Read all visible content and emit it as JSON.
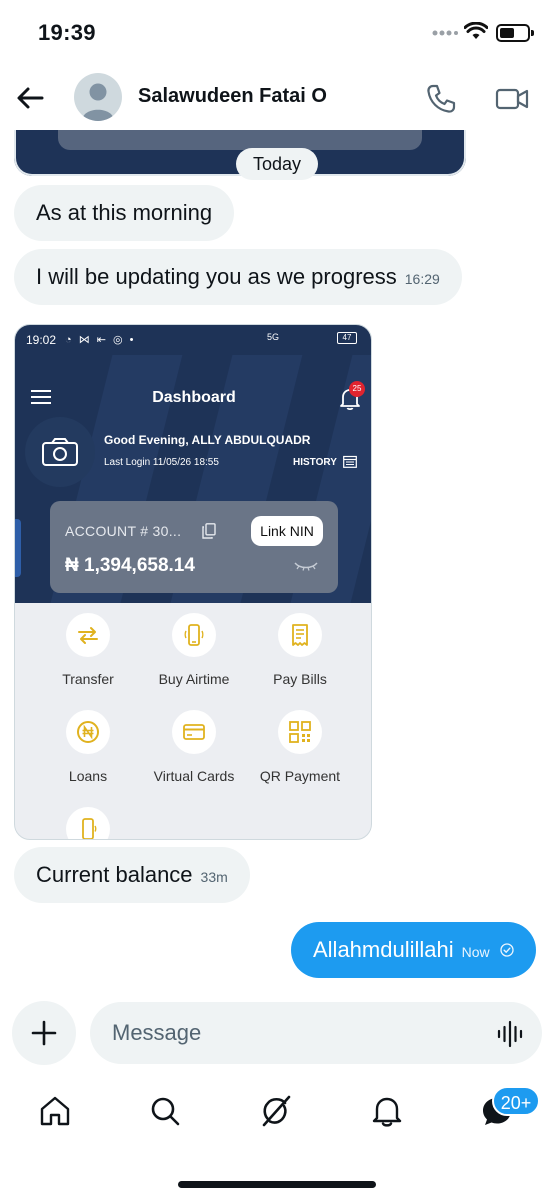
{
  "status_bar": {
    "time": "19:39"
  },
  "header": {
    "contact_name": "Salawudeen Fatai O",
    "icons": [
      "back-arrow-icon",
      "avatar",
      "phone-icon",
      "video-icon"
    ]
  },
  "conversation": {
    "date_separator": "Today",
    "messages": [
      {
        "direction": "in",
        "text": "As at this morning",
        "time": ""
      },
      {
        "direction": "in",
        "text": "I will be updating you as we progress",
        "time": "16:29"
      },
      {
        "direction": "in",
        "type": "image",
        "text": "",
        "time": ""
      },
      {
        "direction": "in",
        "text": "Current balance",
        "time": "33m"
      },
      {
        "direction": "out",
        "text": "Allahmdulillahi",
        "time": "Now",
        "status": "read"
      }
    ]
  },
  "attachment_screenshot": {
    "status_time": "19:02",
    "status_right": "5G",
    "battery": "47",
    "title": "Dashboard",
    "notification_count": "25",
    "greeting": "Good Evening, ALLY ABDULQUADR",
    "last_login": "Last Login 11/05/26 18:55",
    "history_label": "HISTORY",
    "account_label": "ACCOUNT # 30...",
    "link_nin_label": "Link NIN",
    "balance": "₦ 1,394,658.14",
    "actions": [
      {
        "label": "Transfer",
        "icon": "transfer-icon"
      },
      {
        "label": "Buy Airtime",
        "icon": "phone-airtime-icon"
      },
      {
        "label": "Pay Bills",
        "icon": "bill-icon"
      },
      {
        "label": "Loans",
        "icon": "naira-icon"
      },
      {
        "label": "Virtual Cards",
        "icon": "card-icon"
      },
      {
        "label": "QR Payment",
        "icon": "qr-icon"
      },
      {
        "label": "",
        "icon": "mobile-icon"
      }
    ],
    "colors": {
      "navy": "#1e3357",
      "accent_gold": "#e0b21f",
      "badge_red": "#e0242f"
    }
  },
  "composer": {
    "placeholder": "Message",
    "icons": [
      "plus-icon",
      "voice-icon"
    ]
  },
  "bottom_nav": {
    "items": [
      "home-icon",
      "search-icon",
      "grok-icon",
      "notifications-icon",
      "messages-icon"
    ],
    "messages_badge": "20+"
  },
  "colors": {
    "brand_blue": "#1d9bf0",
    "bubble_gray": "#eff3f4",
    "text_secondary": "#536471"
  }
}
